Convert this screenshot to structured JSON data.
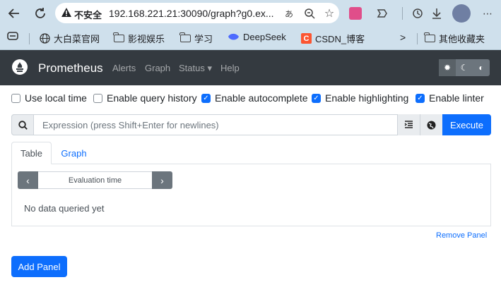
{
  "browser": {
    "url": "192.168.221.21:30090/graph?g0.ex...",
    "security_label": "不安全",
    "bookmarks": [
      "大白菜官网",
      "影视娱乐",
      "学习",
      "DeepSeek",
      "CSDN_博客",
      "其他收藏夹"
    ],
    "more_chevron": ">"
  },
  "navbar": {
    "brand": "Prometheus",
    "links": [
      "Alerts",
      "Graph",
      "Status",
      "Help"
    ],
    "status_caret": "▾"
  },
  "options": {
    "use_local_time": {
      "label": "Use local time",
      "checked": false
    },
    "enable_query_history": {
      "label": "Enable query history",
      "checked": false
    },
    "enable_autocomplete": {
      "label": "Enable autocomplete",
      "checked": true
    },
    "enable_highlighting": {
      "label": "Enable highlighting",
      "checked": true
    },
    "enable_linter": {
      "label": "Enable linter",
      "checked": true
    }
  },
  "expression": {
    "placeholder": "Expression (press Shift+Enter for newlines)",
    "execute_label": "Execute"
  },
  "panel": {
    "tabs": [
      "Table",
      "Graph"
    ],
    "evaluation_time": "Evaluation time",
    "empty_message": "No data queried yet",
    "remove_label": "Remove Panel"
  },
  "add_panel_label": "Add Panel",
  "colors": {
    "primary": "#0d6efd",
    "navbar": "#343a40",
    "chrome": "#cfe0ec"
  }
}
